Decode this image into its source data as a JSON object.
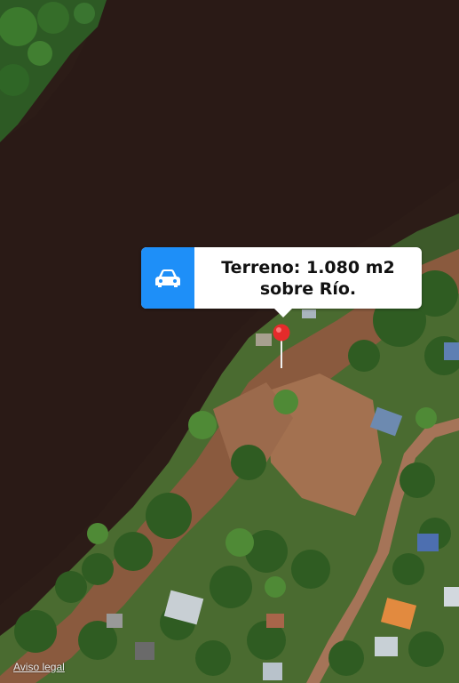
{
  "map": {
    "type": "satellite"
  },
  "callout": {
    "line1": "Terreno: 1.080 m2",
    "line2": "sobre Río.",
    "icon": "car-icon",
    "accent_color": "#1e8ff8"
  },
  "marker": {
    "icon": "map-pin-icon",
    "color": "#e52b2b"
  },
  "footer": {
    "legal_label": "Aviso legal"
  }
}
